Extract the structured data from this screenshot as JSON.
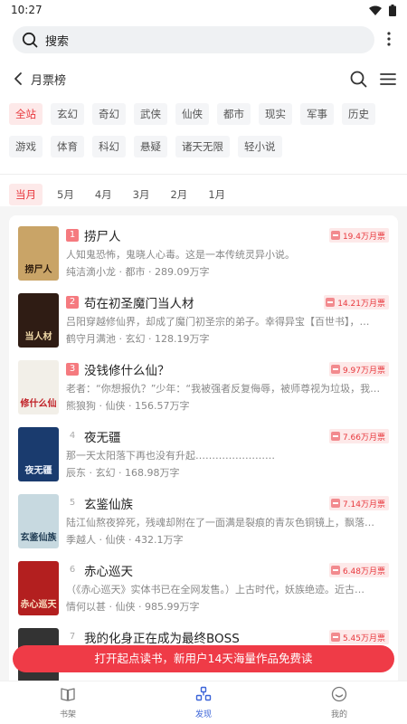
{
  "status": {
    "time": "10:27"
  },
  "search": {
    "placeholder": "搜索"
  },
  "nav": {
    "title": "月票榜"
  },
  "categories": {
    "row1": [
      "全站",
      "玄幻",
      "奇幻",
      "武侠",
      "仙侠",
      "都市",
      "现实",
      "军事",
      "历史"
    ],
    "row2": [
      "游戏",
      "体育",
      "科幻",
      "悬疑",
      "诸天无限",
      "轻小说"
    ],
    "active": "全站"
  },
  "months": [
    "当月",
    "5月",
    "4月",
    "3月",
    "2月",
    "1月"
  ],
  "books": [
    {
      "rank": "1",
      "title": "捞尸人",
      "tickets": "19.4万月票",
      "desc": "人知鬼恐怖，鬼晓人心毒。这是一本传统灵异小说。",
      "meta": "纯洁滴小龙 · 都市 · 289.09万字",
      "cover_text": "捞尸人",
      "cover_bg": "#c9a467",
      "cover_fg": "#2b1a0c"
    },
    {
      "rank": "2",
      "title": "苟在初圣魔门当人材",
      "tickets": "14.21万月票",
      "desc": "吕阳穿越修仙界，却成了魔门初圣宗的弟子。幸得异宝【百世书】，…",
      "meta": "鹤守月满池 · 玄幻 · 128.19万字",
      "cover_text": "当人材",
      "cover_bg": "#2f1c14",
      "cover_fg": "#f0d9a8"
    },
    {
      "rank": "3",
      "title": "没钱修什么仙？",
      "tickets": "9.97万月票",
      "desc": "老者：“你想报仇？”少年：“我被强者反复侮辱，被师尊视为垃圾，我…",
      "meta": "熊狼狗 · 仙侠 · 156.57万字",
      "cover_text": "修什么仙",
      "cover_bg": "#f2efe8",
      "cover_fg": "#c01f25"
    },
    {
      "rank": "4",
      "title": "夜无疆",
      "tickets": "7.66万月票",
      "desc": "那一天太阳落下再也没有升起……………………",
      "meta": "辰东 · 玄幻 · 168.98万字",
      "cover_text": "夜无疆",
      "cover_bg": "#1a3b6e",
      "cover_fg": "#e8eef8"
    },
    {
      "rank": "5",
      "title": "玄鉴仙族",
      "tickets": "7.14万月票",
      "desc": "陆江仙熬夜猝死，残魂却附在了一面满是裂痕的青灰色铜镜上，飘落…",
      "meta": "季越人 · 仙侠 · 432.1万字",
      "cover_text": "玄鉴仙族",
      "cover_bg": "#c7d9e0",
      "cover_fg": "#1d3a52"
    },
    {
      "rank": "6",
      "title": "赤心巡天",
      "tickets": "6.48万月票",
      "desc": "（《赤心巡天》实体书已在全网发售。）上古时代，妖族绝迹。近古…",
      "meta": "情何以甚 · 仙侠 · 985.99万字",
      "cover_text": "赤心巡天",
      "cover_bg": "#b31f1f",
      "cover_fg": "#fbe3c4"
    },
    {
      "rank": "7",
      "title": "我的化身正在成为最终BOSS",
      "tickets": "5.45万月票",
      "desc": "",
      "meta": "",
      "cover_text": "",
      "cover_bg": "#333333",
      "cover_fg": "#ffffff"
    }
  ],
  "cta": {
    "label": "打开起点读书，新用户14天海量作品免费读"
  },
  "bottom_nav": [
    {
      "label": "书架",
      "icon": "book-icon",
      "active": false
    },
    {
      "label": "发现",
      "icon": "discover-icon",
      "active": true
    },
    {
      "label": "我的",
      "icon": "profile-icon",
      "active": false
    }
  ],
  "colors": {
    "accent": "#e8383d",
    "active_nav": "#3a63d8",
    "cta_bg": "#ef3b47"
  }
}
